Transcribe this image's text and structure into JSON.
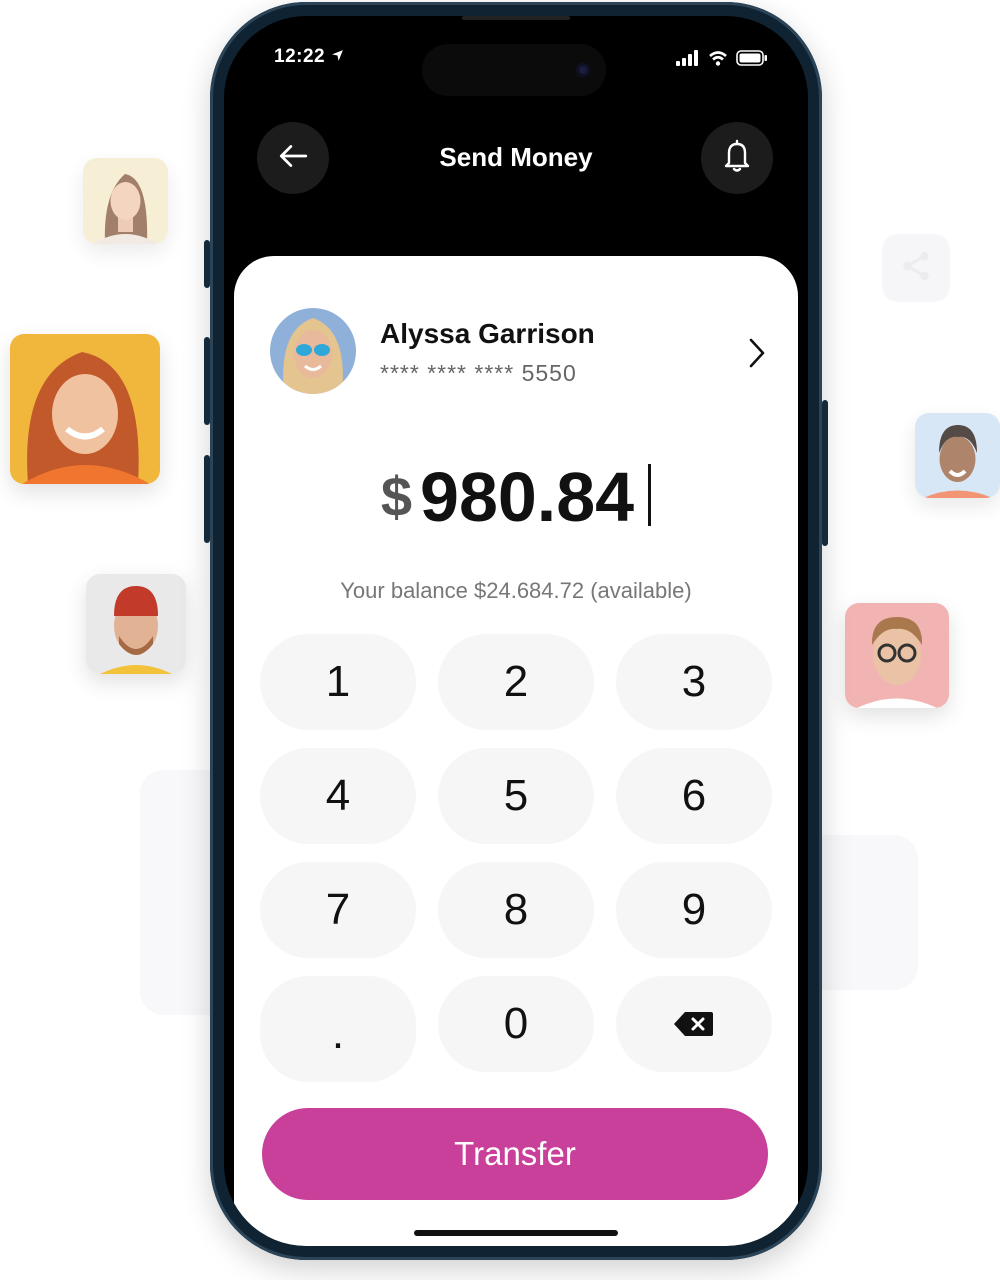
{
  "status_bar": {
    "time": "12:22"
  },
  "header": {
    "title": "Send Money"
  },
  "recipient": {
    "name": "Alyssa Garrison",
    "card_masked": "**** **** **** 5550"
  },
  "amount": {
    "currency": "$",
    "value": "980.84"
  },
  "balance_text": "Your balance $24.684.72 (available)",
  "keypad": {
    "keys": [
      "1",
      "2",
      "3",
      "4",
      "5",
      "6",
      "7",
      "8",
      "9",
      ".",
      "0"
    ]
  },
  "transfer_label": "Transfer",
  "colors": {
    "accent": "#c8409a",
    "phone_frame": "#0f2332",
    "key_bg": "#f6f6f6"
  },
  "icons": [
    "back-arrow-icon",
    "bell-icon",
    "chevron-right-icon",
    "backspace-icon",
    "share-icon",
    "location-arrow-icon",
    "signal-icon",
    "wifi-icon",
    "battery-icon"
  ]
}
